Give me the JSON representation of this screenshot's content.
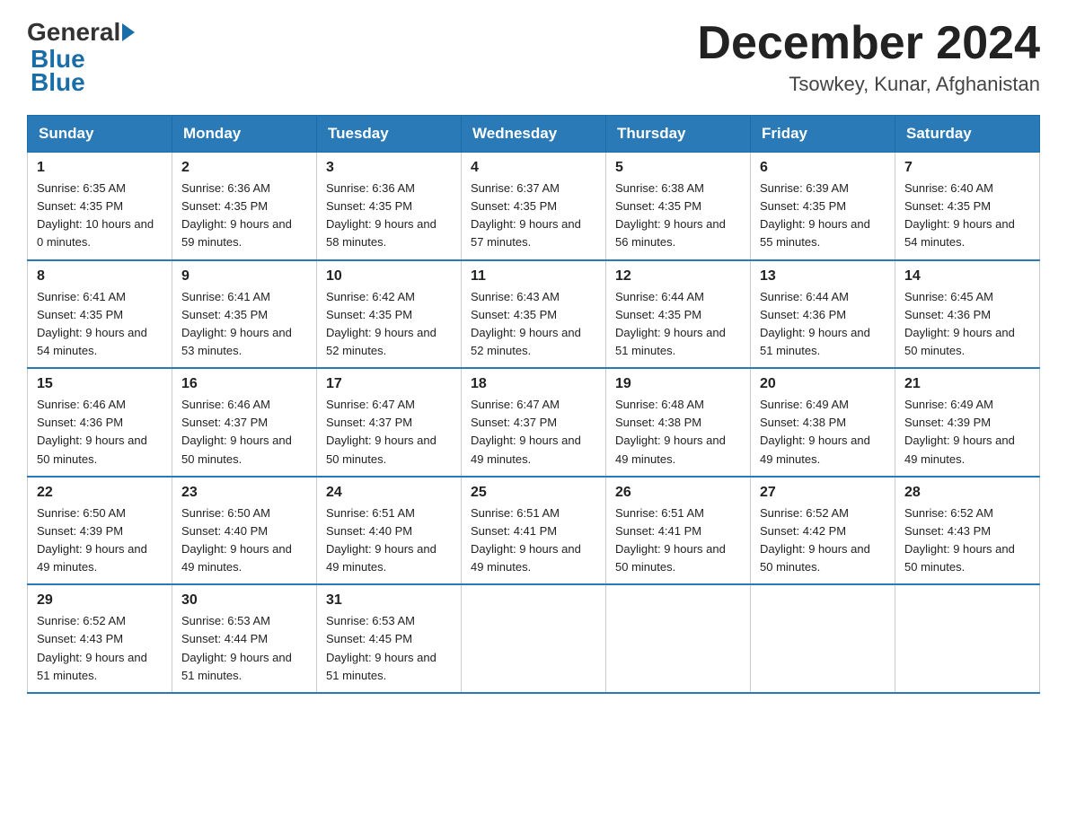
{
  "header": {
    "logo_general": "General",
    "logo_blue": "Blue",
    "month_year": "December 2024",
    "location": "Tsowkey, Kunar, Afghanistan"
  },
  "days_of_week": [
    "Sunday",
    "Monday",
    "Tuesday",
    "Wednesday",
    "Thursday",
    "Friday",
    "Saturday"
  ],
  "weeks": [
    [
      {
        "day": "1",
        "sunrise": "6:35 AM",
        "sunset": "4:35 PM",
        "daylight": "10 hours and 0 minutes."
      },
      {
        "day": "2",
        "sunrise": "6:36 AM",
        "sunset": "4:35 PM",
        "daylight": "9 hours and 59 minutes."
      },
      {
        "day": "3",
        "sunrise": "6:36 AM",
        "sunset": "4:35 PM",
        "daylight": "9 hours and 58 minutes."
      },
      {
        "day": "4",
        "sunrise": "6:37 AM",
        "sunset": "4:35 PM",
        "daylight": "9 hours and 57 minutes."
      },
      {
        "day": "5",
        "sunrise": "6:38 AM",
        "sunset": "4:35 PM",
        "daylight": "9 hours and 56 minutes."
      },
      {
        "day": "6",
        "sunrise": "6:39 AM",
        "sunset": "4:35 PM",
        "daylight": "9 hours and 55 minutes."
      },
      {
        "day": "7",
        "sunrise": "6:40 AM",
        "sunset": "4:35 PM",
        "daylight": "9 hours and 54 minutes."
      }
    ],
    [
      {
        "day": "8",
        "sunrise": "6:41 AM",
        "sunset": "4:35 PM",
        "daylight": "9 hours and 54 minutes."
      },
      {
        "day": "9",
        "sunrise": "6:41 AM",
        "sunset": "4:35 PM",
        "daylight": "9 hours and 53 minutes."
      },
      {
        "day": "10",
        "sunrise": "6:42 AM",
        "sunset": "4:35 PM",
        "daylight": "9 hours and 52 minutes."
      },
      {
        "day": "11",
        "sunrise": "6:43 AM",
        "sunset": "4:35 PM",
        "daylight": "9 hours and 52 minutes."
      },
      {
        "day": "12",
        "sunrise": "6:44 AM",
        "sunset": "4:35 PM",
        "daylight": "9 hours and 51 minutes."
      },
      {
        "day": "13",
        "sunrise": "6:44 AM",
        "sunset": "4:36 PM",
        "daylight": "9 hours and 51 minutes."
      },
      {
        "day": "14",
        "sunrise": "6:45 AM",
        "sunset": "4:36 PM",
        "daylight": "9 hours and 50 minutes."
      }
    ],
    [
      {
        "day": "15",
        "sunrise": "6:46 AM",
        "sunset": "4:36 PM",
        "daylight": "9 hours and 50 minutes."
      },
      {
        "day": "16",
        "sunrise": "6:46 AM",
        "sunset": "4:37 PM",
        "daylight": "9 hours and 50 minutes."
      },
      {
        "day": "17",
        "sunrise": "6:47 AM",
        "sunset": "4:37 PM",
        "daylight": "9 hours and 50 minutes."
      },
      {
        "day": "18",
        "sunrise": "6:47 AM",
        "sunset": "4:37 PM",
        "daylight": "9 hours and 49 minutes."
      },
      {
        "day": "19",
        "sunrise": "6:48 AM",
        "sunset": "4:38 PM",
        "daylight": "9 hours and 49 minutes."
      },
      {
        "day": "20",
        "sunrise": "6:49 AM",
        "sunset": "4:38 PM",
        "daylight": "9 hours and 49 minutes."
      },
      {
        "day": "21",
        "sunrise": "6:49 AM",
        "sunset": "4:39 PM",
        "daylight": "9 hours and 49 minutes."
      }
    ],
    [
      {
        "day": "22",
        "sunrise": "6:50 AM",
        "sunset": "4:39 PM",
        "daylight": "9 hours and 49 minutes."
      },
      {
        "day": "23",
        "sunrise": "6:50 AM",
        "sunset": "4:40 PM",
        "daylight": "9 hours and 49 minutes."
      },
      {
        "day": "24",
        "sunrise": "6:51 AM",
        "sunset": "4:40 PM",
        "daylight": "9 hours and 49 minutes."
      },
      {
        "day": "25",
        "sunrise": "6:51 AM",
        "sunset": "4:41 PM",
        "daylight": "9 hours and 49 minutes."
      },
      {
        "day": "26",
        "sunrise": "6:51 AM",
        "sunset": "4:41 PM",
        "daylight": "9 hours and 50 minutes."
      },
      {
        "day": "27",
        "sunrise": "6:52 AM",
        "sunset": "4:42 PM",
        "daylight": "9 hours and 50 minutes."
      },
      {
        "day": "28",
        "sunrise": "6:52 AM",
        "sunset": "4:43 PM",
        "daylight": "9 hours and 50 minutes."
      }
    ],
    [
      {
        "day": "29",
        "sunrise": "6:52 AM",
        "sunset": "4:43 PM",
        "daylight": "9 hours and 51 minutes."
      },
      {
        "day": "30",
        "sunrise": "6:53 AM",
        "sunset": "4:44 PM",
        "daylight": "9 hours and 51 minutes."
      },
      {
        "day": "31",
        "sunrise": "6:53 AM",
        "sunset": "4:45 PM",
        "daylight": "9 hours and 51 minutes."
      },
      null,
      null,
      null,
      null
    ]
  ]
}
